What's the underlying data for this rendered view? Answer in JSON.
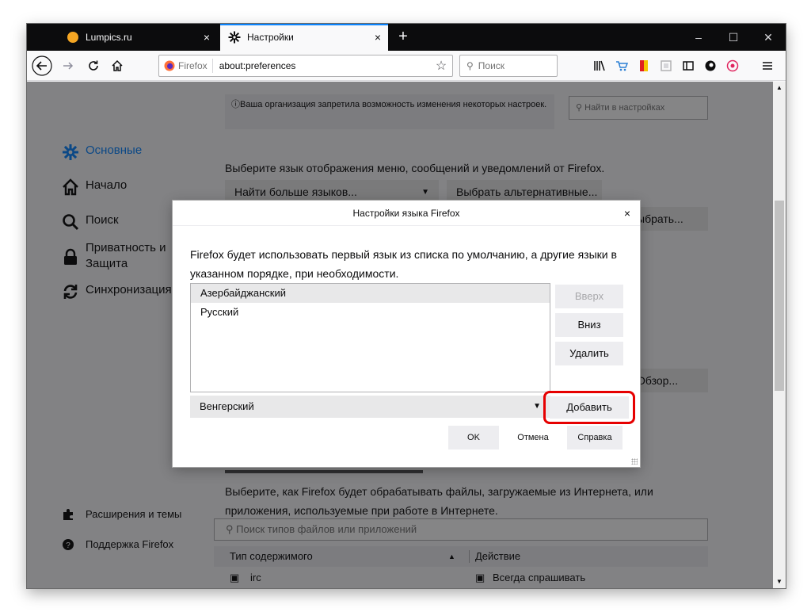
{
  "tabs": [
    {
      "title": "Lumpics.ru",
      "close": "×"
    },
    {
      "title": "Настройки",
      "close": "×"
    }
  ],
  "newtab_label": "+",
  "window_controls": {
    "minimize": "–",
    "maximize": "☐",
    "close": "✕"
  },
  "toolbar": {
    "identity_label": "Firefox",
    "url": "about:preferences",
    "search_placeholder": "Поиск"
  },
  "colors": {
    "accent": "#0a84ff",
    "highlight_ring": "#e60000"
  },
  "prefs": {
    "policy_notice": "Ваша организация запретила возможность изменения некоторых настроек.",
    "find_placeholder": "Найти в настройках",
    "nav": [
      {
        "label": "Основные"
      },
      {
        "label": "Начало"
      },
      {
        "label": "Поиск"
      },
      {
        "label": "Приватность и Защита"
      },
      {
        "label": "Синхронизация"
      }
    ],
    "bottom_nav": [
      {
        "label": "Расширения и темы"
      },
      {
        "label": "Поддержка Firefox"
      }
    ],
    "language_text": "Выберите язык отображения меню, сообщений и уведомлений от Firefox.",
    "find_more_languages": "Найти больше языков...",
    "select_alternatives": "Выбрать альтернативные...",
    "choose_partial": "ыбрать...",
    "browse_partial": "Обзор...",
    "applications_text": "Выберите, как Firefox будет обрабатывать файлы, загружаемые из Интернета, или приложения, используемые при работе в Интернете.",
    "app_search_placeholder": "Поиск типов файлов или приложений",
    "col_content_type": "Тип содержимого",
    "col_action": "Действие",
    "row_type": "irc",
    "row_action": "Всегда спрашивать"
  },
  "dialog": {
    "title": "Настройки языка Firefox",
    "close": "×",
    "description": "Firefox будет использовать первый язык из списка по умолчанию, а другие языки в указанном порядке, при необходимости.",
    "languages": [
      "Азербайджанский",
      "Русский"
    ],
    "move_up": "Вверх",
    "move_down": "Вниз",
    "remove": "Удалить",
    "add_select_value": "Венгерский",
    "add": "Добавить",
    "ok": "OK",
    "cancel": "Отмена",
    "help": "Справка"
  }
}
